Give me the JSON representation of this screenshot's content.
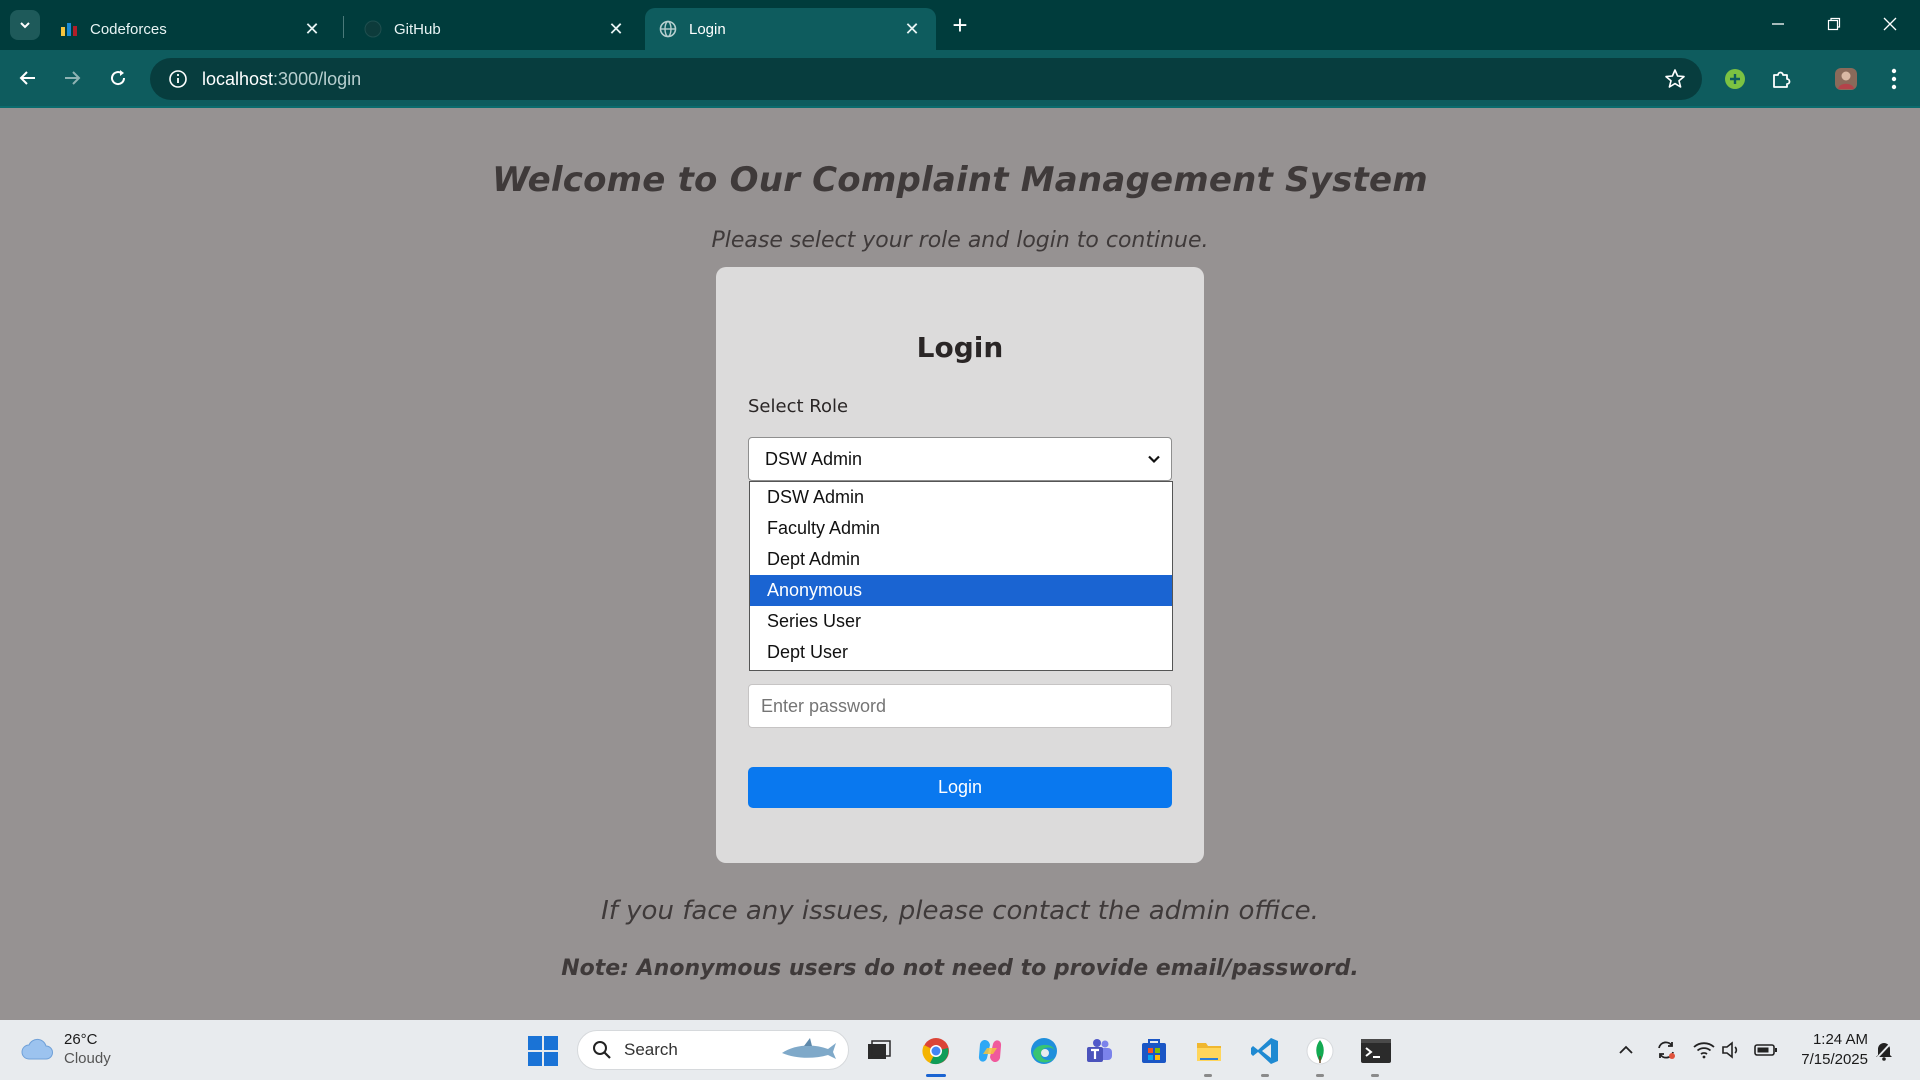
{
  "browser": {
    "tabs": [
      {
        "title": "Codeforces",
        "favicon": "codeforces-icon",
        "active": false
      },
      {
        "title": "GitHub",
        "favicon": "github-icon",
        "active": false
      },
      {
        "title": "Login",
        "favicon": "globe-icon",
        "active": true
      }
    ],
    "url_host": "localhost",
    "url_path": ":3000/login",
    "accent": "#0e5c5e"
  },
  "page": {
    "welcome": "Welcome to Our Complaint Management System",
    "subtitle": "Please select your role and login to continue.",
    "card": {
      "title": "Login",
      "role_label": "Select Role",
      "selected_role": "DSW Admin",
      "options": [
        "DSW Admin",
        "Faculty Admin",
        "Dept Admin",
        "Anonymous",
        "Series User",
        "Dept User"
      ],
      "highlighted_option": "Anonymous",
      "password_placeholder": "Enter password",
      "login_button": "Login"
    },
    "issues_text": "If you face any issues, please contact the admin office.",
    "note_text": "Note: Anonymous users do not need to provide email/password."
  },
  "taskbar": {
    "weather_temp": "26°C",
    "weather_condition": "Cloudy",
    "search_label": "Search",
    "time": "1:24 AM",
    "date": "7/15/2025"
  }
}
